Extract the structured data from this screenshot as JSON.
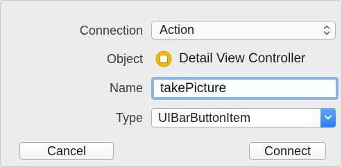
{
  "connection": {
    "label": "Connection",
    "value": "Action",
    "icon": "up-down-arrows-icon"
  },
  "object": {
    "label": "Object",
    "value": "Detail View Controller",
    "icon": "view-controller-icon",
    "icon_color": "#f5b800"
  },
  "name": {
    "label": "Name",
    "value": "takePicture"
  },
  "type": {
    "label": "Type",
    "value": "UIBarButtonItem",
    "icon": "chevron-down-icon",
    "accent": "#2e7ef2"
  },
  "buttons": {
    "cancel": "Cancel",
    "connect": "Connect"
  }
}
